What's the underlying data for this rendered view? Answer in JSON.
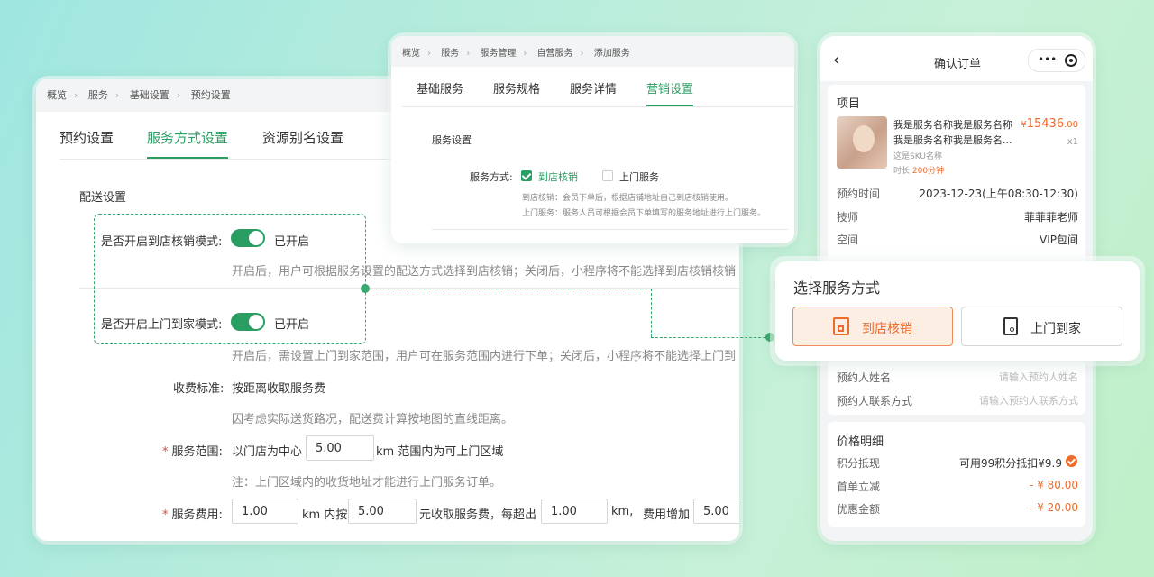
{
  "left_panel": {
    "breadcrumb": [
      "概览",
      "服务",
      "基础设置",
      "预约设置"
    ],
    "tabs": [
      {
        "label": "预约设置",
        "active": false
      },
      {
        "label": "服务方式设置",
        "active": true
      },
      {
        "label": "资源别名设置",
        "active": false
      }
    ],
    "section_title": "配送设置",
    "store_mode": {
      "label": "是否开启到店核销模式:",
      "enabled": true,
      "status": "已开启",
      "hint": "开启后，用户可根据服务设置的配送方式选择到店核销；关闭后，小程序将不能选择到店核销核销"
    },
    "home_mode": {
      "label": "是否开启上门到家模式:",
      "enabled": true,
      "status": "已开启",
      "hint": "开启后，需设置上门到家范围，用户可在服务范围内进行下单；关闭后，小程序将不能选择上门到"
    },
    "fee_standard": {
      "label": "收费标准:",
      "value": "按距离收取服务费",
      "hint": "因考虑实际送货路况，配送费计算按地图的直线距离。"
    },
    "service_range": {
      "required_mark": "*",
      "label": "服务范围:",
      "prefix": "以门店为中心",
      "value": "5.00",
      "suffix": "km 范围内为可上门区域",
      "note": "注：上门区域内的收货地址才能进行上门服务订单。"
    },
    "service_fee": {
      "required_mark": "*",
      "label": "服务费用:",
      "v1": "1.00",
      "t1": "km 内按",
      "v2": "5.00",
      "t2": "元收取服务费，每超出",
      "v3": "1.00",
      "t3": "km,",
      "t4": "费用增加",
      "v4": "5.00"
    }
  },
  "middle_panel": {
    "breadcrumb": [
      "概览",
      "服务",
      "服务管理",
      "自营服务",
      "添加服务"
    ],
    "tabs": [
      {
        "label": "基础服务",
        "active": false
      },
      {
        "label": "服务规格",
        "active": false
      },
      {
        "label": "服务详情",
        "active": false
      },
      {
        "label": "营销设置",
        "active": true
      }
    ],
    "section_title": "服务设置",
    "method_label": "服务方式:",
    "options": [
      {
        "label": "到店核销",
        "checked": true
      },
      {
        "label": "上门服务",
        "checked": false
      }
    ],
    "desc1": "到店核销：会员下单后，根据店铺地址自己到店核销使用。",
    "desc2": "上门服务：服务人员可根据会员下单填写的服务地址进行上门服务。"
  },
  "phone": {
    "title": "确认订单",
    "back_icon": "chevron-left-icon",
    "more_icon": "more-dots-icon",
    "target_icon": "target-icon",
    "project_title": "项目",
    "product_name_l1": "我是服务名称我是服务名称",
    "product_name_l2": "我是服务名称我是服务名...",
    "price_symbol": "¥",
    "price_int": "15436",
    "price_dec": ".00",
    "qty": "x1",
    "sku": "这是SKU名称",
    "duration_label": "时长",
    "duration_value": "200分钟",
    "rows": [
      {
        "label": "预约时间",
        "value": "2023-12-23(上午08:30-12:30)"
      },
      {
        "label": "技师",
        "value": "菲菲菲老师"
      },
      {
        "label": "空间",
        "value": "VIP包间"
      }
    ],
    "contact_rows": [
      {
        "label": "预约人姓名",
        "placeholder": "请输入预约人姓名"
      },
      {
        "label": "预约人联系方式",
        "placeholder": "请输入预约人联系方式"
      }
    ],
    "price_title": "价格明细",
    "points_label": "积分抵现",
    "points_value": "可用99积分抵扣¥9.9",
    "discount_label": "首单立减",
    "discount_value": "- ¥ 80.00",
    "coupon_label": "优惠金额",
    "coupon_value": "- ¥ 20.00"
  },
  "popup": {
    "title": "选择服务方式",
    "options": [
      {
        "label": "到店核销",
        "icon": "store-icon",
        "selected": true
      },
      {
        "label": "上门到家",
        "icon": "home-door-icon",
        "selected": false
      }
    ]
  },
  "colors": {
    "primary_green": "#2a9d62",
    "accent_orange": "#ee6b2c"
  }
}
